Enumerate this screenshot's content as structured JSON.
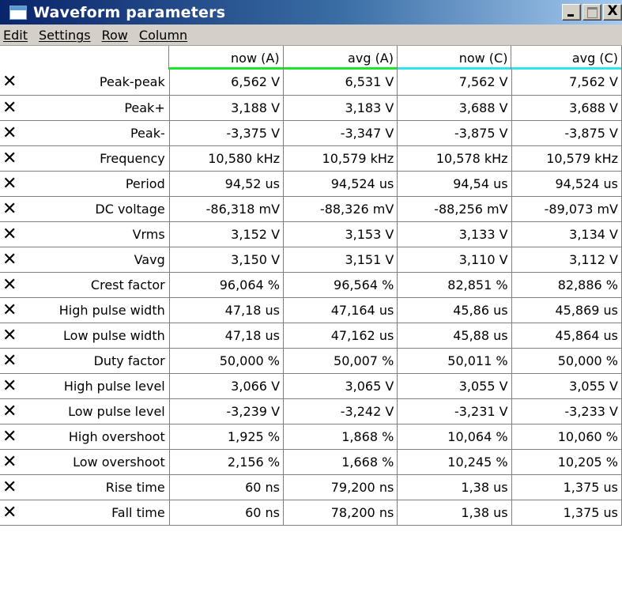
{
  "window": {
    "title": "Waveform parameters",
    "close_glyph": "X"
  },
  "menu": [
    {
      "label": "Edit"
    },
    {
      "label": "Settings"
    },
    {
      "label": "Row"
    },
    {
      "label": "Column"
    }
  ],
  "columns": [
    {
      "label": "now (A)",
      "color": "#1ee62a"
    },
    {
      "label": "avg (A)",
      "color": "#1ee62a"
    },
    {
      "label": "now (C)",
      "color": "#2ee6ee"
    },
    {
      "label": "avg (C)",
      "color": "#2ee6ee"
    }
  ],
  "remove_glyph": "✕",
  "rows": [
    {
      "name": "Peak-peak",
      "values": [
        "6,562 V",
        "6,531 V",
        "7,562 V",
        "7,562 V"
      ]
    },
    {
      "name": "Peak+",
      "values": [
        "3,188 V",
        "3,183 V",
        "3,688 V",
        "3,688 V"
      ]
    },
    {
      "name": "Peak-",
      "values": [
        "-3,375 V",
        "-3,347 V",
        "-3,875 V",
        "-3,875 V"
      ]
    },
    {
      "name": "Frequency",
      "values": [
        "10,580 kHz",
        "10,579 kHz",
        "10,578 kHz",
        "10,579 kHz"
      ]
    },
    {
      "name": "Period",
      "values": [
        "94,52 us",
        "94,524 us",
        "94,54 us",
        "94,524 us"
      ]
    },
    {
      "name": "DC voltage",
      "values": [
        "-86,318 mV",
        "-88,326 mV",
        "-88,256 mV",
        "-89,073 mV"
      ]
    },
    {
      "name": "Vrms",
      "values": [
        "3,152 V",
        "3,153 V",
        "3,133 V",
        "3,134 V"
      ]
    },
    {
      "name": "Vavg",
      "values": [
        "3,150 V",
        "3,151 V",
        "3,110 V",
        "3,112 V"
      ]
    },
    {
      "name": "Crest factor",
      "values": [
        "96,064 %",
        "96,564 %",
        "82,851 %",
        "82,886 %"
      ]
    },
    {
      "name": "High pulse width",
      "values": [
        "47,18 us",
        "47,164 us",
        "45,86 us",
        "45,869 us"
      ]
    },
    {
      "name": "Low pulse width",
      "values": [
        "47,18 us",
        "47,162 us",
        "45,88 us",
        "45,864 us"
      ]
    },
    {
      "name": "Duty factor",
      "values": [
        "50,000 %",
        "50,007 %",
        "50,011 %",
        "50,000 %"
      ]
    },
    {
      "name": "High pulse level",
      "values": [
        "3,066 V",
        "3,065 V",
        "3,055 V",
        "3,055 V"
      ]
    },
    {
      "name": "Low pulse level",
      "values": [
        "-3,239 V",
        "-3,242 V",
        "-3,231 V",
        "-3,233 V"
      ]
    },
    {
      "name": "High overshoot",
      "values": [
        "1,925 %",
        "1,868 %",
        "10,064 %",
        "10,060 %"
      ]
    },
    {
      "name": "Low overshoot",
      "values": [
        "2,156 %",
        "1,668 %",
        "10,245 %",
        "10,205 %"
      ]
    },
    {
      "name": "Rise time",
      "values": [
        "60 ns",
        "79,200 ns",
        "1,38 us",
        "1,375 us"
      ]
    },
    {
      "name": "Fall time",
      "values": [
        "60 ns",
        "78,200 ns",
        "1,38 us",
        "1,375 us"
      ]
    }
  ]
}
